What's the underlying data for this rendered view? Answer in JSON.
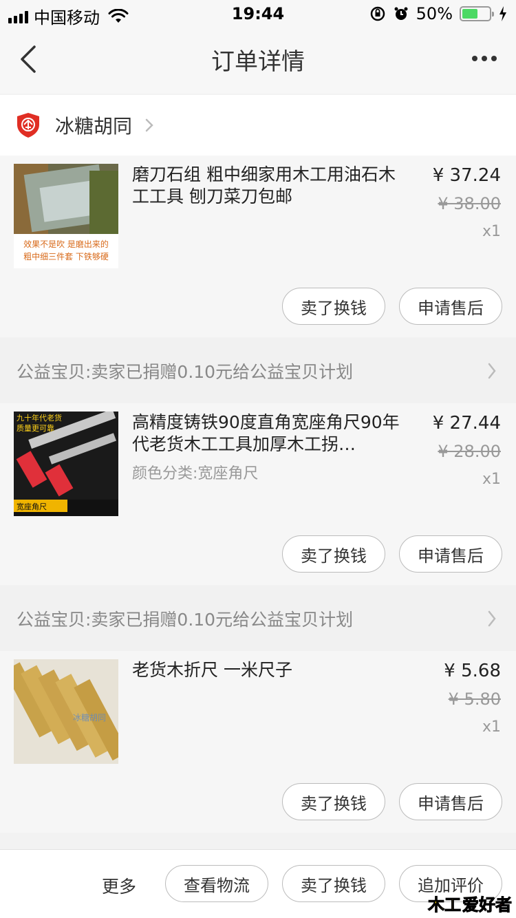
{
  "status_bar": {
    "carrier": "中国移动",
    "time": "19:44",
    "battery": "50%"
  },
  "nav": {
    "title": "订单详情"
  },
  "shop": {
    "name": "冰糖胡同"
  },
  "items": [
    {
      "title": "磨刀石组 粗中细家用木工用油石木工工具 刨刀菜刀包邮",
      "sub": "",
      "price": "¥ 37.24",
      "original_price": "¥ 38.00",
      "qty": "x1",
      "thumb_caption_1": "效果不是吹 是磨出来的",
      "thumb_caption_2": "粗中细三件套 下铁够硬",
      "sell_label": "卖了换钱",
      "after_sale_label": "申请售后"
    },
    {
      "title": "高精度铸铁90度直角宽座角尺90年代老货木工工具加厚木工拐…",
      "sub": "颜色分类:宽座角尺",
      "price": "¥ 27.44",
      "original_price": "¥ 28.00",
      "qty": "x1",
      "thumb_caption_1": "九十年代老货",
      "thumb_caption_2": "质量更可靠",
      "thumb_caption_3": "宽座角尺",
      "sell_label": "卖了换钱",
      "after_sale_label": "申请售后"
    },
    {
      "title": "老货木折尺 一米尺子",
      "sub": "",
      "price": "¥ 5.68",
      "original_price": "¥ 5.80",
      "qty": "x1",
      "thumb_caption_1": "冰糖胡同",
      "sell_label": "卖了换钱",
      "after_sale_label": "申请售后"
    }
  ],
  "charity": {
    "text": "公益宝贝:卖家已捐赠0.10元给公益宝贝计划"
  },
  "bottom_bar": {
    "more": "更多",
    "logistics": "查看物流",
    "sell": "卖了换钱",
    "review": "追加评价"
  },
  "watermark": {
    "part1": "木工",
    "part2": "爱好者"
  },
  "colors": {
    "accent_red": "#e02e24",
    "battery_green": "#4cd964"
  }
}
